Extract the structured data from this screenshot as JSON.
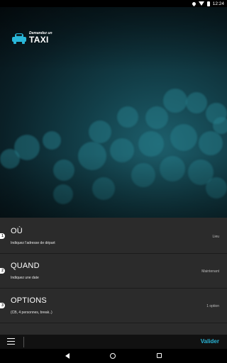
{
  "status_bar": {
    "time": "12:24"
  },
  "logo": {
    "tagline": "Demandez un",
    "name": "TAXI"
  },
  "rows": [
    {
      "number": "1",
      "title": "OÙ",
      "subtitle": "Indiquez l'adresse de départ",
      "value": "Lieu"
    },
    {
      "number": "2",
      "title": "QUAND",
      "subtitle": "Indiquez une date",
      "value": "Maintenant"
    },
    {
      "number": "3",
      "title": "OPTIONS",
      "subtitle": "(CB, 4 personnes, break..)",
      "value": "1 option"
    }
  ],
  "toolbar": {
    "validate_label": "Valider"
  },
  "colors": {
    "accent": "#29b6d8",
    "panel": "#2b2b2b",
    "toolbar": "#111111"
  }
}
